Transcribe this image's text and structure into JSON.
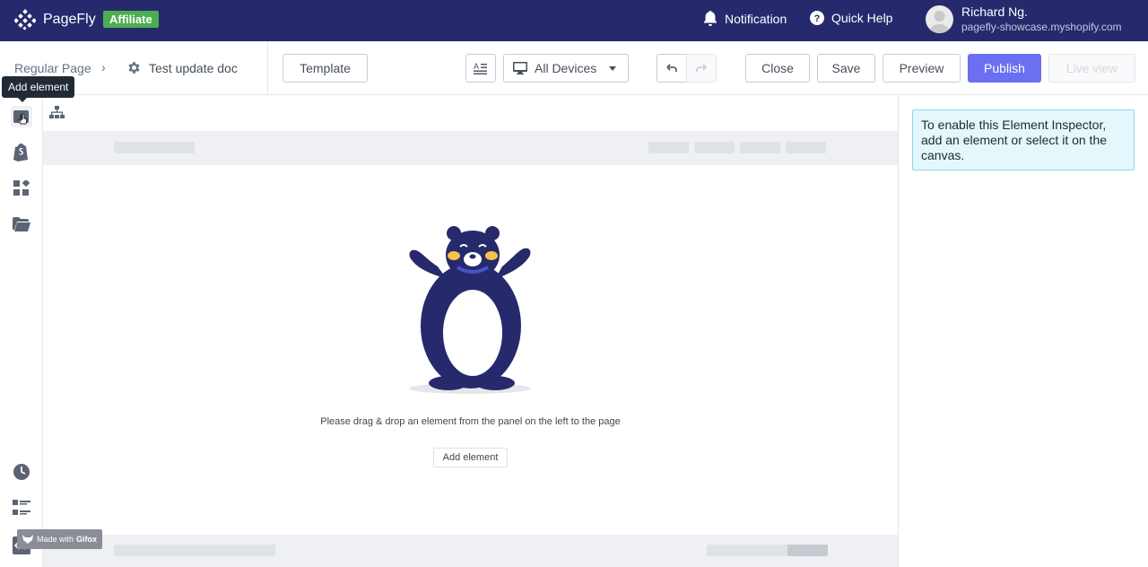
{
  "header": {
    "brand": "PageFly",
    "badge": "Affiliate",
    "notification": "Notification",
    "quick_help": "Quick Help",
    "user_name": "Richard Ng.",
    "user_store": "pagefly-showcase.myshopify.com"
  },
  "toolbar": {
    "breadcrumb": "Regular Page",
    "breadcrumb_sep": "›",
    "page_name": "Test update doc",
    "template": "Template",
    "devices": "All Devices",
    "close": "Close",
    "save": "Save",
    "preview": "Preview",
    "publish": "Publish",
    "live_view": "Live view"
  },
  "sidebar": {
    "tooltip": "Add element",
    "icons": [
      "add-element-icon",
      "shopify-icon",
      "widgets-icon",
      "folder-icon",
      "history-icon",
      "list-icon",
      "code-icon"
    ]
  },
  "canvas": {
    "empty_message": "Please drag & drop an element from the panel on the left to the page",
    "add_element": "Add element"
  },
  "inspector": {
    "message": "To enable this Element Inspector, add an element or select it on the canvas."
  },
  "watermark": {
    "made_with": "Made with",
    "brand": "Gifox"
  },
  "colors": {
    "header_bg": "#262a6c",
    "badge": "#4cae50",
    "primary": "#6b70f2",
    "inspector_bg": "#e4f8fc",
    "bear": "#262a6c"
  }
}
